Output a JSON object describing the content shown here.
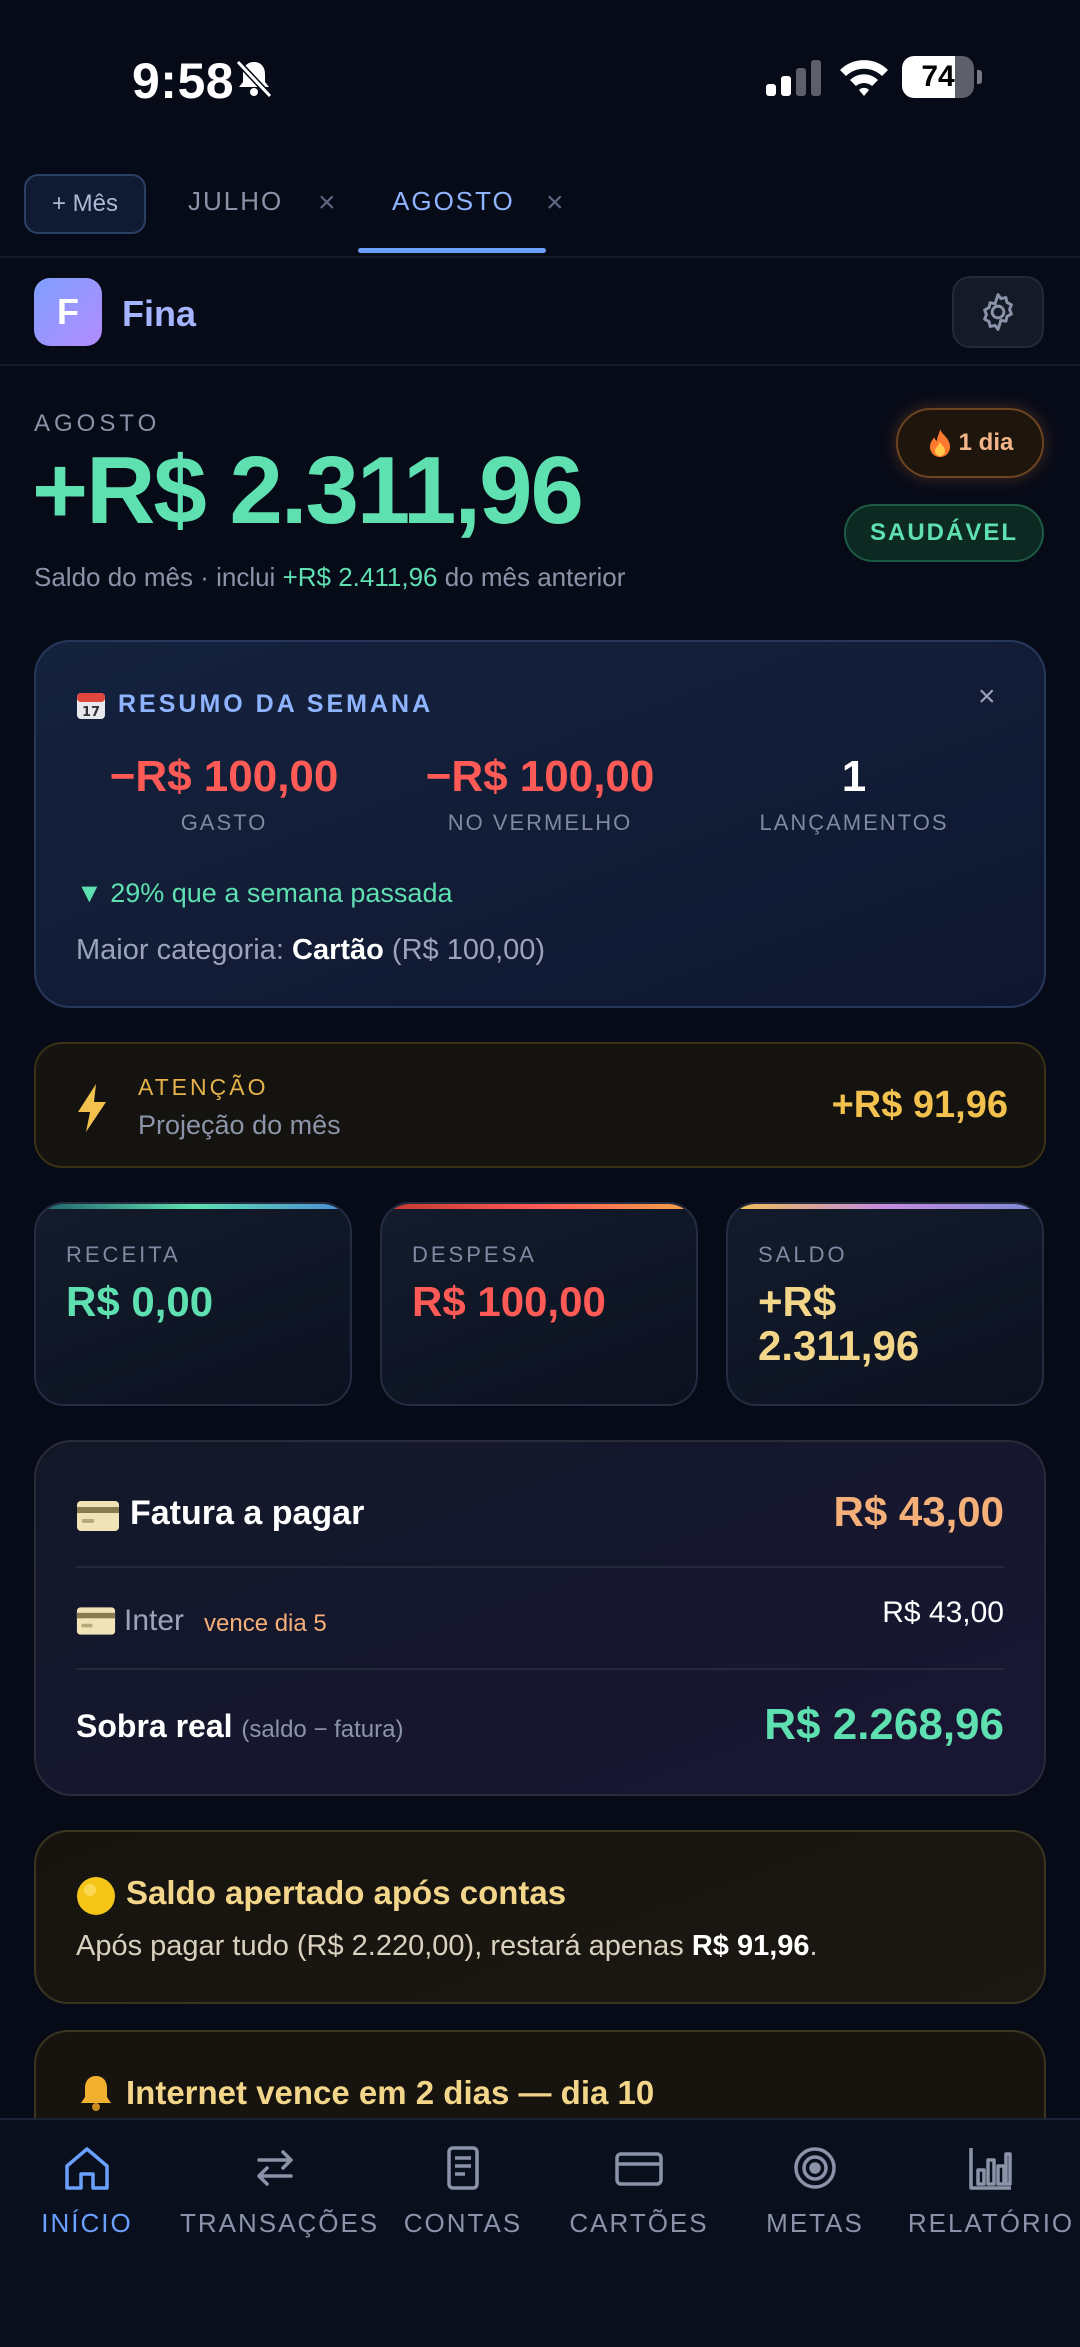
{
  "status_bar": {
    "time": "9:58",
    "battery": "74",
    "battery_level": 0.74
  },
  "month_tabs": {
    "add_label": "+ Mês",
    "tabs": [
      {
        "label": "JULHO",
        "close": "×"
      },
      {
        "label": "AGOSTO",
        "close": "×"
      }
    ],
    "active": "AGOSTO"
  },
  "header": {
    "logo_letter": "F",
    "app_name": "Fina"
  },
  "balance": {
    "month_label": "AGOSTO",
    "amount": "+R$ 2.311,96",
    "sub_prefix": "Saldo do mês · inclui ",
    "sub_highlight": "+R$ 2.411,96",
    "sub_suffix": " do mês anterior",
    "streak": "1 dia",
    "health": "SAUDÁVEL"
  },
  "week_summary": {
    "title": "RESUMO DA SEMANA",
    "close": "×",
    "stats": [
      {
        "value": "−R$ 100,00",
        "label": "GASTO"
      },
      {
        "value": "−R$ 100,00",
        "label": "NO VERMELHO"
      },
      {
        "value": "1",
        "label": "LANÇAMENTOS"
      }
    ],
    "trend": "▼ 29% que a semana passada",
    "top_category_prefix": "Maior categoria: ",
    "top_category_name": "Cartão",
    "top_category_value": " (R$ 100,00)"
  },
  "attention": {
    "title": "ATENÇÃO",
    "subtitle": "Projeção do mês",
    "value": "+R$ 91,96"
  },
  "summary_cards": [
    {
      "label": "RECEITA",
      "value": "R$ 0,00",
      "color": "#5ee0b0"
    },
    {
      "label": "DESPESA",
      "value": "R$ 100,00",
      "color": "#ff5a55"
    },
    {
      "label": "SALDO",
      "value_line1": "+R$",
      "value_line2": "2.311,96",
      "color": "#f4d68a"
    }
  ],
  "invoice": {
    "title": "Fatura a pagar",
    "total": "R$ 43,00",
    "bank": "Inter",
    "due": "vence dia 5",
    "bank_value": "R$ 43,00",
    "leftover_label": "Sobra real",
    "leftover_note": "(saldo − fatura)",
    "leftover_value": "R$ 2.268,96"
  },
  "tight_balance": {
    "title": "Saldo apertado após contas",
    "body_prefix": "Após pagar tudo (R$ 2.220,00), restará apenas ",
    "body_value": "R$ 91,96",
    "body_suffix": "."
  },
  "alert": {
    "title": "Internet vence em 2 dias — dia 10"
  },
  "bottom_nav": [
    {
      "label": "INÍCIO",
      "icon": "home-icon",
      "active": true
    },
    {
      "label": "TRANSAÇÕES",
      "icon": "arrows-icon",
      "active": false
    },
    {
      "label": "CONTAS",
      "icon": "document-icon",
      "active": false
    },
    {
      "label": "CARTÕES",
      "icon": "card-icon",
      "active": false
    },
    {
      "label": "METAS",
      "icon": "target-icon",
      "active": false
    },
    {
      "label": "RELATÓRIO",
      "icon": "chart-icon",
      "active": false
    }
  ],
  "colors": {
    "background": "#070b18",
    "accent_blue": "#6aa0ff",
    "positive": "#5ee0b0",
    "negative": "#ff5a55",
    "warning": "#f2c14e"
  }
}
